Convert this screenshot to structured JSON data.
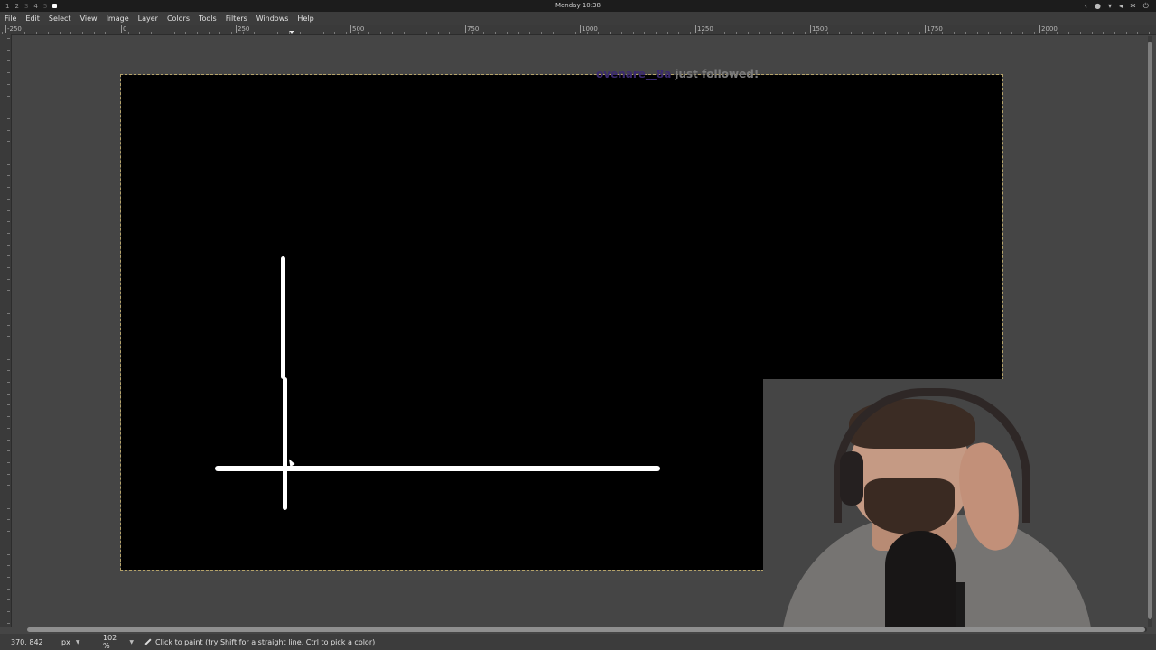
{
  "system_bar": {
    "workspaces": [
      "1",
      "2",
      "3",
      "4",
      "5"
    ],
    "clock": "Monday 10:38"
  },
  "menu": [
    "File",
    "Edit",
    "Select",
    "View",
    "Image",
    "Layer",
    "Colors",
    "Tools",
    "Filters",
    "Windows",
    "Help"
  ],
  "ruler": {
    "ticks": [
      "-250",
      "0",
      "250",
      "500",
      "750",
      "1000",
      "1250",
      "1500",
      "1750",
      "2000"
    ]
  },
  "canvas": {
    "background": "#000000",
    "stroke_color": "#ffffff"
  },
  "overlay": {
    "follower": "ovenare__8a",
    "message": "just followed!"
  },
  "statusbar": {
    "coords": "370, 842",
    "unit": "px",
    "zoom": "102 %",
    "hint": "Click to paint (try Shift for a straight line, Ctrl to pick a color)"
  }
}
